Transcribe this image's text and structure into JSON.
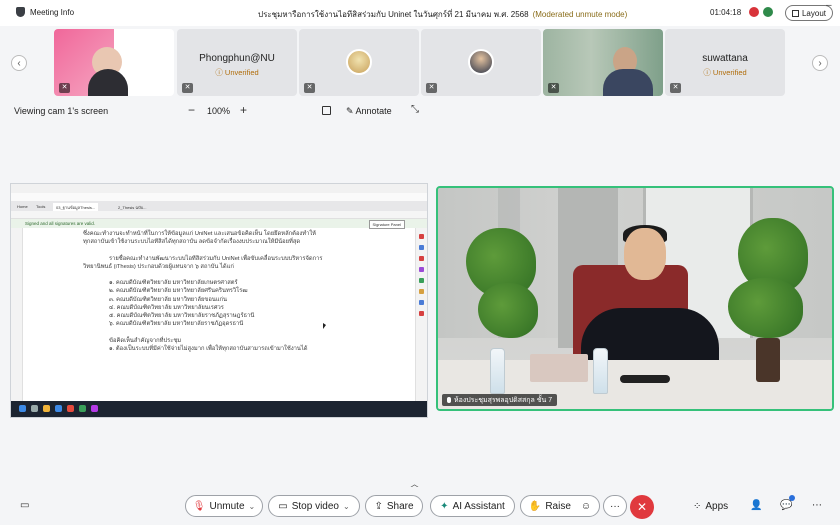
{
  "topbar": {
    "meeting_info": "Meeting Info",
    "title": "ประชุมหารือการใช้งานไอทีสิสร่วมกับ Uninet ในวันศุกร์ที่ 21 มีนาคม พ.ศ. 2568",
    "mode": "(Moderated unmute mode)",
    "clock": "01:04:18",
    "layout_label": "Layout"
  },
  "participants": [
    {
      "name": "",
      "status": ""
    },
    {
      "name": "Phongphun@NU",
      "status": "Unverified"
    },
    {
      "name": "",
      "status": ""
    },
    {
      "name": "",
      "status": ""
    },
    {
      "name": "",
      "status": ""
    },
    {
      "name": "suwattana",
      "status": "Unverified"
    }
  ],
  "view": {
    "viewing_label": "Viewing cam 1's screen",
    "zoom": "100%",
    "annotate": "Annotate"
  },
  "shared_screen": {
    "tabs": [
      "Home",
      "Tools",
      "03_ฐานข้อมูลThesis...",
      "2_Thesis ฉบับ..."
    ],
    "signed_notice": "Signed and all signatures are valid.",
    "signature_panel": "Signature Panel",
    "doc_lines": [
      "ซึ่งคณะทำงานจะทำหน้าที่ในการให้ข้อมูลแก่ UniNet และเสนอข้อคิดเห็น โดยยึดหลักต้องทำให้",
      "ทุกสถาบันเข้าใช้งานระบบไอทีสิสได้ทุกสถาบัน ลดข้อจำกัดเรื่องงบประมาณให้มีน้อยที่สุด",
      "",
      "รายชื่อคณะทำงานพัฒนาระบบไอทีสิสร่วมกับ UniNet เพื่อขับเคลื่อนระบบบริหารจัดการ",
      "วิทยานิพนธ์ (iThesis) ประกอบด้วยผู้แทนจาก ๖ สถาบัน ได้แก่",
      "",
      "๑. คณบดีบัณฑิตวิทยาลัย มหาวิทยาลัยเกษตรศาสตร์",
      "๒. คณบดีบัณฑิตวิทยาลัย มหาวิทยาลัยศรีนครินทรวิโรฒ",
      "๓. คณบดีบัณฑิตวิทยาลัย มหาวิทยาลัยขอนแก่น",
      "๔. คณบดีบัณฑิตวิทยาลัย มหาวิทยาลัยนเรศวร",
      "๕. คณบดีบัณฑิตวิทยาลัย มหาวิทยาลัยราชภัฏสุราษฎร์ธานี",
      "๖. คณบดีบัณฑิตวิทยาลัย มหาวิทยาลัยราชภัฏอุดรธานี",
      "",
      "ข้อคิดเห็นสำคัญจากที่ประชุม",
      "๑. ต้องเป็นระบบที่มีค่าใช้จ่ายไม่สูงมาก เพื่อให้ทุกสถาบันสามารถเข้ามาใช้งานได้"
    ]
  },
  "camera": {
    "label": "ห้องประชุมสุรพลอุปดิสสกุล ชั้น 7"
  },
  "toolbar": {
    "unmute": "Unmute",
    "stop_video": "Stop video",
    "share": "Share",
    "ai_assistant": "AI Assistant",
    "raise": "Raise",
    "apps": "Apps"
  },
  "colors": {
    "accent_green": "#35c17a",
    "leave_red": "#e0393e",
    "unverified_orange": "#b06d0b"
  }
}
